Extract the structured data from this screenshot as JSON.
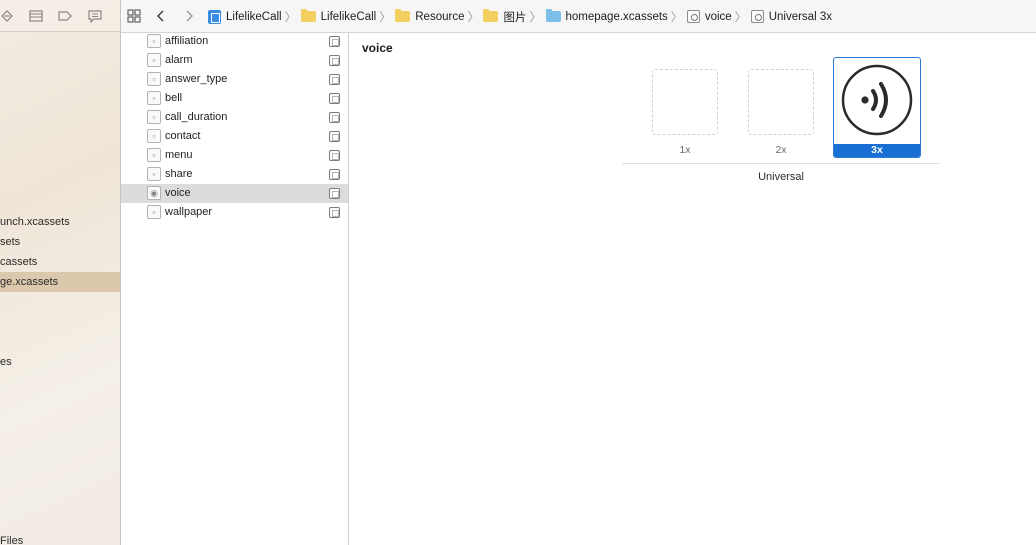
{
  "navigator": {
    "items": [
      {
        "label": "unch.xcassets",
        "selected": false
      },
      {
        "label": "sets",
        "selected": false
      },
      {
        "label": "cassets",
        "selected": false
      },
      {
        "label": "ge.xcassets",
        "selected": true
      },
      {
        "label": "es",
        "selected": false
      },
      {
        "label": "Files",
        "selected": false
      }
    ]
  },
  "jumpbar": {
    "crumbs": [
      {
        "label": "LifelikeCall",
        "icon": "project-icon"
      },
      {
        "label": "LifelikeCall",
        "icon": "folder-icon"
      },
      {
        "label": "Resource",
        "icon": "folder-icon"
      },
      {
        "label": "图片",
        "icon": "folder-icon"
      },
      {
        "label": "homepage.xcassets",
        "icon": "asset-catalog-icon"
      },
      {
        "label": "voice",
        "icon": "image-set-icon"
      },
      {
        "label": "Universal 3x",
        "icon": "image-set-icon"
      }
    ]
  },
  "assets": [
    {
      "name": "affiliation",
      "selected": false
    },
    {
      "name": "alarm",
      "selected": false
    },
    {
      "name": "answer_type",
      "selected": false
    },
    {
      "name": "bell",
      "selected": false
    },
    {
      "name": "call_duration",
      "selected": false
    },
    {
      "name": "contact",
      "selected": false
    },
    {
      "name": "menu",
      "selected": false
    },
    {
      "name": "share",
      "selected": false
    },
    {
      "name": "voice",
      "selected": true
    },
    {
      "name": "wallpaper",
      "selected": false
    }
  ],
  "detail": {
    "title": "voice",
    "slots": [
      {
        "label": "1x",
        "filled": false
      },
      {
        "label": "2x",
        "filled": false
      },
      {
        "label": "3x",
        "filled": true,
        "icon": "voice-waves-icon"
      }
    ],
    "group_label": "Universal"
  },
  "colors": {
    "selection_blue": "#1a6fd4",
    "navigator_selected": "#dcc9ad",
    "folder_yellow": "#f2cf5e",
    "catalog_blue": "#7cc0ea"
  }
}
